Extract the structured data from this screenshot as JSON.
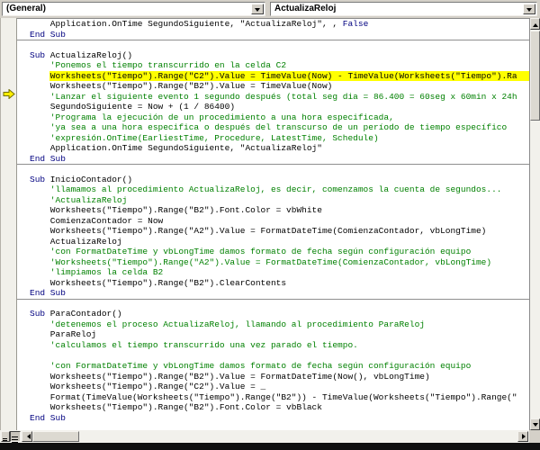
{
  "toolbar": {
    "object_dropdown": "(General)",
    "procedure_dropdown": "ActualizaReloj"
  },
  "colors": {
    "keyword": "#000080",
    "comment": "#008000",
    "plain": "#000000",
    "highlight": "#ffff00",
    "chrome": "#d4d0c8"
  },
  "icons": {
    "execution_point": "yellow-arrow-right",
    "combo_arrows": "chevron-down",
    "view_buttons": [
      "procedure-view",
      "full-module-view"
    ]
  },
  "editor": {
    "lines": [
      {
        "s": [
          [
            "n",
            "    Application.OnTime SegundoSiguiente, \"ActualizaReloj\", , "
          ],
          [
            "k",
            "False"
          ]
        ]
      },
      {
        "s": [
          [
            "k",
            "End Sub"
          ]
        ]
      },
      {
        "d": true
      },
      {
        "s": [
          [
            "k",
            "Sub"
          ],
          [
            "n",
            " ActualizaReloj()"
          ]
        ]
      },
      {
        "s": [
          [
            "c",
            "    'Ponemos el tiempo transcurrido en la celda C2"
          ]
        ]
      },
      {
        "h": true,
        "s": [
          [
            "n",
            "    Worksheets(\"Tiempo\").Range(\"C2\").Value = TimeValue(Now) - TimeValue(Worksheets(\"Tiempo\").Ra"
          ]
        ]
      },
      {
        "s": [
          [
            "n",
            "    Worksheets(\"Tiempo\").Range(\"B2\").Value = TimeValue(Now)"
          ]
        ]
      },
      {
        "s": [
          [
            "c",
            "    'Lanzar el siguiente evento 1 segundo después (total seg dia = 86.400 = 60seg x 60min x 24h"
          ]
        ]
      },
      {
        "s": [
          [
            "n",
            "    SegundoSiguiente = Now + (1 / 86400)"
          ]
        ]
      },
      {
        "s": [
          [
            "c",
            "    'Programa la ejecución de un procedimiento a una hora especificada,"
          ]
        ]
      },
      {
        "s": [
          [
            "c",
            "    'ya sea a una hora especifica o después del transcurso de un período de tiempo específico"
          ]
        ]
      },
      {
        "s": [
          [
            "c",
            "    'expresión.OnTime(EarliestTime, Procedure, LatestTime, Schedule)"
          ]
        ]
      },
      {
        "s": [
          [
            "n",
            "    Application.OnTime SegundoSiguiente, \"ActualizaReloj\""
          ]
        ]
      },
      {
        "s": [
          [
            "k",
            "End Sub"
          ]
        ]
      },
      {
        "d": true
      },
      {
        "s": [
          [
            "k",
            "Sub"
          ],
          [
            "n",
            " InicioContador()"
          ]
        ]
      },
      {
        "s": [
          [
            "c",
            "    'llamamos al procedimiento ActualizaReloj, es decir, comenzamos la cuenta de segundos..."
          ]
        ]
      },
      {
        "s": [
          [
            "c",
            "    'ActualizaReloj"
          ]
        ]
      },
      {
        "s": [
          [
            "n",
            "    Worksheets(\"Tiempo\").Range(\"B2\").Font.Color = vbWhite"
          ]
        ]
      },
      {
        "s": [
          [
            "n",
            "    ComienzaContador = Now"
          ]
        ]
      },
      {
        "s": [
          [
            "n",
            "    Worksheets(\"Tiempo\").Range(\"A2\").Value = FormatDateTime(ComienzaContador, vbLongTime)"
          ]
        ]
      },
      {
        "s": [
          [
            "n",
            "    ActualizaReloj"
          ]
        ]
      },
      {
        "s": [
          [
            "c",
            "    'con FormatDateTime y vbLongTime damos formato de fecha según configuración equipo"
          ]
        ]
      },
      {
        "s": [
          [
            "c",
            "    'Worksheets(\"Tiempo\").Range(\"A2\").Value = FormatDateTime(ComienzaContador, vbLongTime)"
          ]
        ]
      },
      {
        "s": [
          [
            "c",
            "    'limpiamos la celda B2"
          ]
        ]
      },
      {
        "s": [
          [
            "n",
            "    Worksheets(\"Tiempo\").Range(\"B2\").ClearContents"
          ]
        ]
      },
      {
        "s": [
          [
            "k",
            "End Sub"
          ]
        ]
      },
      {
        "d": true
      },
      {
        "s": [
          [
            "k",
            "Sub"
          ],
          [
            "n",
            " ParaContador()"
          ]
        ]
      },
      {
        "s": [
          [
            "c",
            "    'detenemos el proceso ActualizaReloj, llamando al procedimiento ParaReloj"
          ]
        ]
      },
      {
        "s": [
          [
            "n",
            "    ParaReloj"
          ]
        ]
      },
      {
        "s": [
          [
            "c",
            "    'calculamos el tiempo transcurrido una vez parado el tiempo."
          ]
        ]
      },
      {
        "s": []
      },
      {
        "s": [
          [
            "c",
            "    'con FormatDateTime y vbLongTime damos formato de fecha según configuración equipo"
          ]
        ]
      },
      {
        "s": [
          [
            "n",
            "    Worksheets(\"Tiempo\").Range(\"B2\").Value = FormatDateTime(Now(), vbLongTime)"
          ]
        ]
      },
      {
        "s": [
          [
            "n",
            "    Worksheets(\"Tiempo\").Range(\"C2\").Value = _"
          ]
        ]
      },
      {
        "s": [
          [
            "n",
            "    Format(TimeValue(Worksheets(\"Tiempo\").Range(\"B2\")) - TimeValue(Worksheets(\"Tiempo\").Range(\""
          ]
        ]
      },
      {
        "s": [
          [
            "n",
            "    Worksheets(\"Tiempo\").Range(\"B2\").Font.Color = vbBlack"
          ]
        ]
      },
      {
        "s": [
          [
            "k",
            "End Sub"
          ]
        ]
      }
    ]
  }
}
